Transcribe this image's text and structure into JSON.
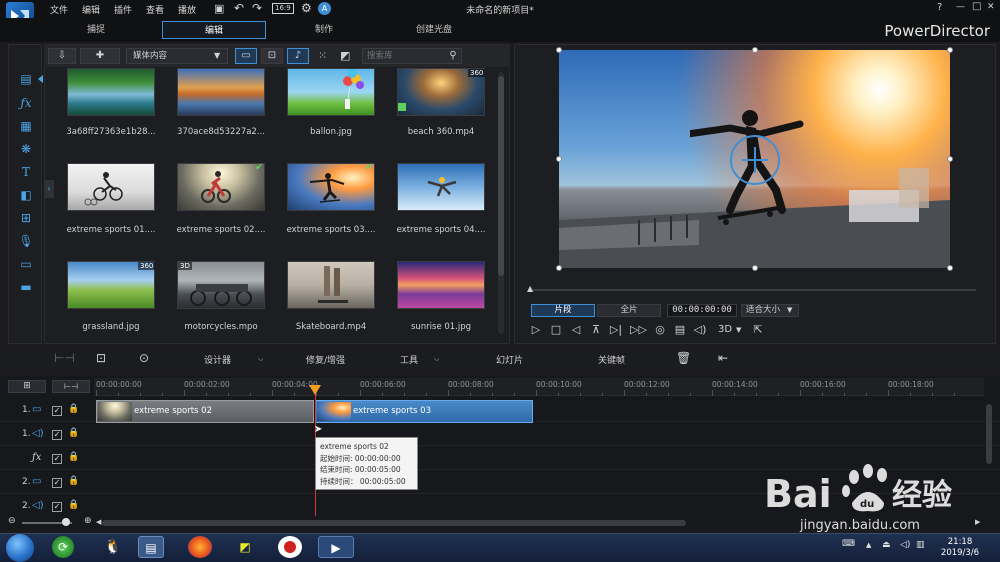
{
  "titlebar": {
    "menus": [
      "文件",
      "编辑",
      "插件",
      "查看",
      "播放"
    ],
    "title": "未命名的新项目*",
    "help": "?",
    "minimize": "—",
    "maximize": "□",
    "close": "✕",
    "toolbar_icons": [
      "save-icon",
      "undo-icon",
      "redo-icon",
      "aspect-ratio-icon",
      "settings-icon",
      "notification-icon"
    ],
    "aspect": "16:9"
  },
  "modes": {
    "tabs": [
      {
        "label": "捕捉"
      },
      {
        "label": "编辑"
      },
      {
        "label": "制作"
      },
      {
        "label": "创建光盘"
      }
    ],
    "active_index": 1,
    "brand": "PowerDirector"
  },
  "library": {
    "media_select": "媒体内容",
    "search_placeholder": "搜索库",
    "items": [
      {
        "caption": "3a68ff27363e1b28...",
        "badge": ""
      },
      {
        "caption": "370ace8d53227a2...",
        "badge": ""
      },
      {
        "caption": "ballon.jpg",
        "badge": ""
      },
      {
        "caption": "beach 360.mp4",
        "badge": "360"
      },
      {
        "caption": "extreme sports 01....",
        "badge": ""
      },
      {
        "caption": "extreme sports 02....",
        "badge": ""
      },
      {
        "caption": "extreme sports 03....",
        "badge": ""
      },
      {
        "caption": "extreme sports 04....",
        "badge": ""
      },
      {
        "caption": "grassland.jpg",
        "badge": "360"
      },
      {
        "caption": "motorcycles.mpo",
        "badge": "3D"
      },
      {
        "caption": "Skateboard.mp4",
        "badge": ""
      },
      {
        "caption": "sunrise 01.jpg",
        "badge": ""
      }
    ]
  },
  "preview": {
    "segment_clip": "片段",
    "segment_full": "全片",
    "timecode": "00:00:00:00",
    "fit": "适合大小",
    "three_d": "3D"
  },
  "timeline_toolbar": {
    "designer": "设计器",
    "fix_enhance": "修复/增强",
    "tools": "工具",
    "slideshow": "幻灯片",
    "keyframe": "关键帧"
  },
  "timeline": {
    "ruler_labels": [
      "00:00:00:00",
      "00:00:02:00",
      "00:00:04:00",
      "00:00:06:00",
      "00:00:08:00",
      "00:00:10:00",
      "00:00:12:00",
      "00:00:14:00",
      "00:00:16:00",
      "00:00:18:00"
    ],
    "tracks": [
      {
        "num": "1.",
        "type": "video"
      },
      {
        "num": "1.",
        "type": "audio"
      },
      {
        "num": "",
        "type": "fx"
      },
      {
        "num": "2.",
        "type": "video"
      },
      {
        "num": "2.",
        "type": "audio"
      }
    ],
    "clips": [
      {
        "label": "extreme sports 02"
      },
      {
        "label": "extreme sports 03"
      }
    ],
    "tooltip": {
      "name": "extreme sports 02",
      "start": "起始时间: 00:00:00:00",
      "end": "结束时间: 00:00:05:00",
      "duration": "持续时间： 00:00:05:00"
    }
  },
  "taskbar": {
    "time": "21:18",
    "date": "2019/3/6"
  },
  "watermark": {
    "brand": "Bai",
    "cn": "经验",
    "site": "jingyan.baidu.com"
  }
}
